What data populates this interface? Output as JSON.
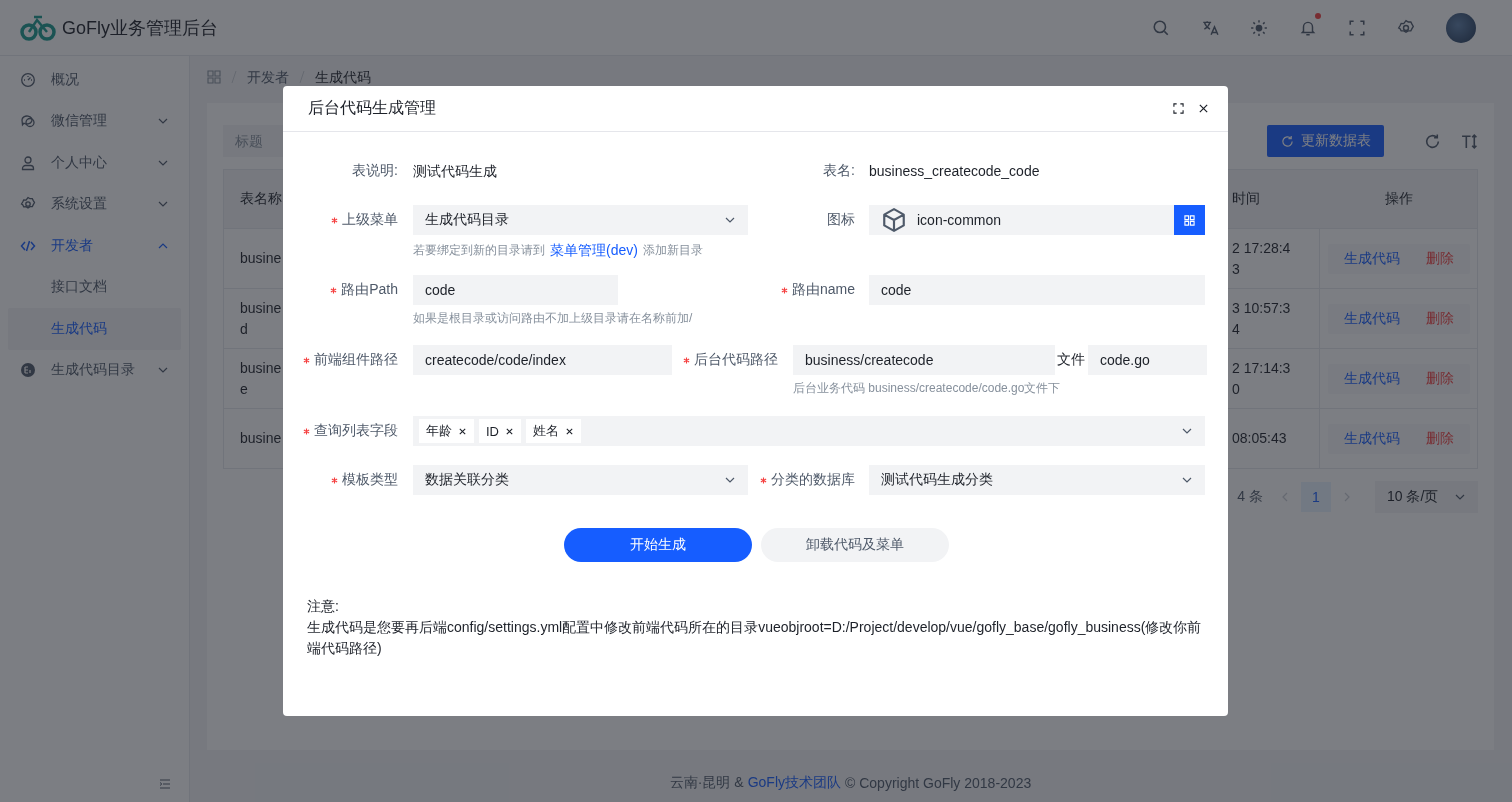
{
  "app": {
    "title": "GoFly业务管理后台",
    "has_unread_notifications": true
  },
  "sidebar": {
    "items": [
      {
        "label": "概况",
        "kind": "link"
      },
      {
        "label": "微信管理",
        "kind": "group",
        "expanded": false
      },
      {
        "label": "个人中心",
        "kind": "group",
        "expanded": false
      },
      {
        "label": "系统设置",
        "kind": "group",
        "expanded": false
      },
      {
        "label": "开发者",
        "kind": "group",
        "expanded": true,
        "children": [
          {
            "label": "接口文档",
            "selected": false
          },
          {
            "label": "生成代码",
            "selected": true
          }
        ]
      },
      {
        "label": "生成代码目录",
        "kind": "group",
        "expanded": false
      }
    ]
  },
  "breadcrumb": [
    "开发者",
    "生成代码"
  ],
  "toolbar": {
    "search_placeholder": "标题",
    "update_button": "更新数据表"
  },
  "table": {
    "columns": [
      "表名称",
      "时间",
      "操作"
    ],
    "rows": [
      {
        "name": [
          "busine"
        ],
        "time": [
          "2 17:28:4",
          "3"
        ],
        "actions": [
          {
            "label": "生成代码",
            "kind": "primary"
          },
          {
            "label": "删除",
            "kind": "danger"
          }
        ]
      },
      {
        "name": [
          "busine",
          "d"
        ],
        "time": [
          "3 10:57:3",
          "4"
        ],
        "actions": [
          {
            "label": "生成代码",
            "kind": "primary"
          },
          {
            "label": "删除",
            "kind": "danger"
          }
        ]
      },
      {
        "name": [
          "busine",
          "e"
        ],
        "time": [
          "2 17:14:3",
          "0"
        ],
        "actions": [
          {
            "label": "生成代码",
            "kind": "primary"
          },
          {
            "label": "删除",
            "kind": "danger"
          }
        ]
      },
      {
        "name": [
          "busine"
        ],
        "time": [
          "08:05:43"
        ],
        "actions": [
          {
            "label": "生成代码",
            "kind": "primary"
          },
          {
            "label": "删除",
            "kind": "danger"
          }
        ]
      }
    ]
  },
  "pagination": {
    "total": "4 条",
    "pages": [
      {
        "label": "1",
        "selected": true
      }
    ],
    "page_size": "10 条/页"
  },
  "dialog": {
    "title": "后台代码生成管理",
    "info": [
      {
        "label": "表说明:",
        "value": "测试代码生成"
      },
      {
        "label": "表名:",
        "value": "business_createcode_code"
      }
    ],
    "parent_menu": {
      "label": "上级菜单",
      "required": true,
      "value": "生成代码目录",
      "hint": {
        "before": "若要绑定到新的目录请到",
        "link": "菜单管理(dev)",
        "after": "添加新目录"
      }
    },
    "icon_field": {
      "label": "图标",
      "value": "icon-common"
    },
    "route_path": {
      "label": "路由Path",
      "required": true,
      "value": "code",
      "hint": "如果是根目录或访问路由不加上级目录请在名称前加/"
    },
    "route_name": {
      "label": "路由name",
      "required": true,
      "value": "code"
    },
    "frontend_path": {
      "label": "前端组件路径",
      "required": true,
      "value": "createcode/code/index"
    },
    "backend_path": {
      "label": "后台代码路径",
      "required": true,
      "value": "business/createcode",
      "file_label": "文件",
      "file_value": "code.go",
      "hint": "后台业务代码 business/createcode/code.go文件下"
    },
    "list_fields": {
      "label": "查询列表字段",
      "required": true,
      "tags": [
        "年龄",
        "ID",
        "姓名"
      ]
    },
    "template_type": {
      "label": "模板类型",
      "required": true,
      "value": "数据关联分类"
    },
    "category_db": {
      "label": "分类的数据库",
      "required": true,
      "value": "测试代码生成分类"
    },
    "buttons": [
      {
        "label": "开始生成",
        "kind": "primary"
      },
      {
        "label": "卸载代码及菜单",
        "kind": "secondary"
      }
    ],
    "note": {
      "title": "注意:",
      "text": "生成代码是您要再后端config/settings.yml配置中修改前端代码所在的目录vueobjroot=D:/Project/develop/vue/gofly_base/gofly_business(修改你前端代码路径)"
    }
  },
  "footer": {
    "prefix": "云南·昆明 &",
    "link": "GoFly技术团队",
    "suffix": "© Copyright GoFly 2018-2023"
  }
}
